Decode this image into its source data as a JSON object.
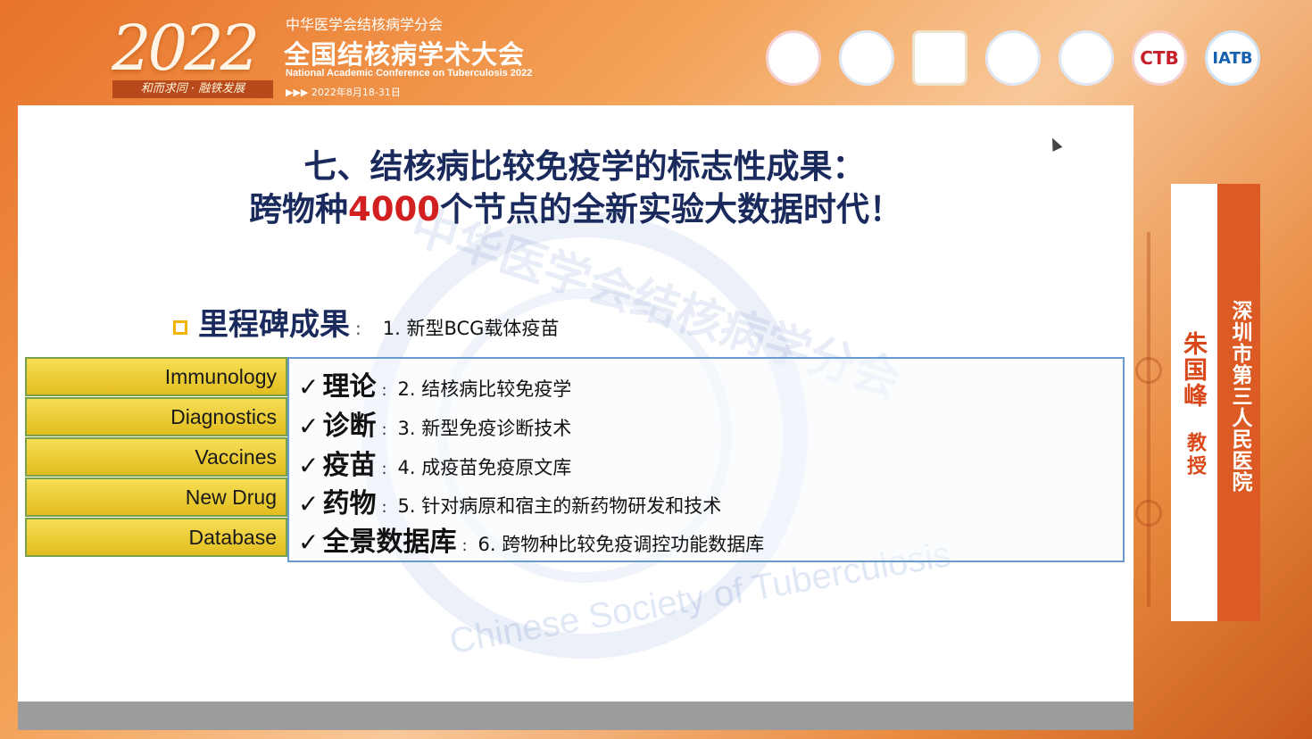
{
  "header": {
    "year": "2022",
    "slogan": "和而求同 · 融铁发展",
    "society_cn": "中华医学会结核病学分会",
    "conference_cn": "全国结核病学术大会",
    "conference_en": "National Academic Conference on Tuberculosis 2022",
    "date": "▶▶▶ 2022年8月18-31日",
    "logos": [
      "",
      "",
      "",
      "",
      "",
      "CTB",
      "IATB"
    ]
  },
  "slide": {
    "title_line1": "七、结核病比较免疫学的标志性成果：",
    "title_line2_prefix": "跨物种",
    "title_line2_highlight": "4000",
    "title_line2_suffix": "个节点的全新实验大数据时代！",
    "milestone_title": "里程碑成果",
    "milestone_colon": ":",
    "milestone_item": "1.  新型BCG载体疫苗",
    "watermark_top": "中华医学会结核病学分会",
    "watermark_bottom": "Chinese Society of Tuberculosis",
    "labels": [
      "Immunology",
      "Diagnostics",
      "Vaccines",
      "New Drug",
      "Database"
    ],
    "items": [
      {
        "check": "✓",
        "head": "理论",
        "colon": ":",
        "text": "2.  结核病比较免疫学"
      },
      {
        "check": "✓",
        "head": "诊断",
        "colon": ":",
        "text": "3.  新型免疫诊断技术"
      },
      {
        "check": "✓",
        "head": "疫苗",
        "colon": ":",
        "text": "4.  成疫苗免疫原文库"
      },
      {
        "check": "✓",
        "head": "药物",
        "colon": ":",
        "text": "5.  针对病原和宿主的新药物研发和技术"
      },
      {
        "check": "✓",
        "head": "全景数据库",
        "colon": ":",
        "text": "6.  跨物种比较免疫调控功能数据库"
      }
    ]
  },
  "speaker": {
    "name": "朱国峰",
    "title": "教授",
    "institution": "深圳市第三人民医院"
  },
  "colors": {
    "accent_orange": "#e8732a",
    "title_navy": "#1a2a5c",
    "highlight_red": "#d21f1f",
    "label_yellow": "#f0cf3a",
    "box_border_blue": "#6a9ad0"
  }
}
